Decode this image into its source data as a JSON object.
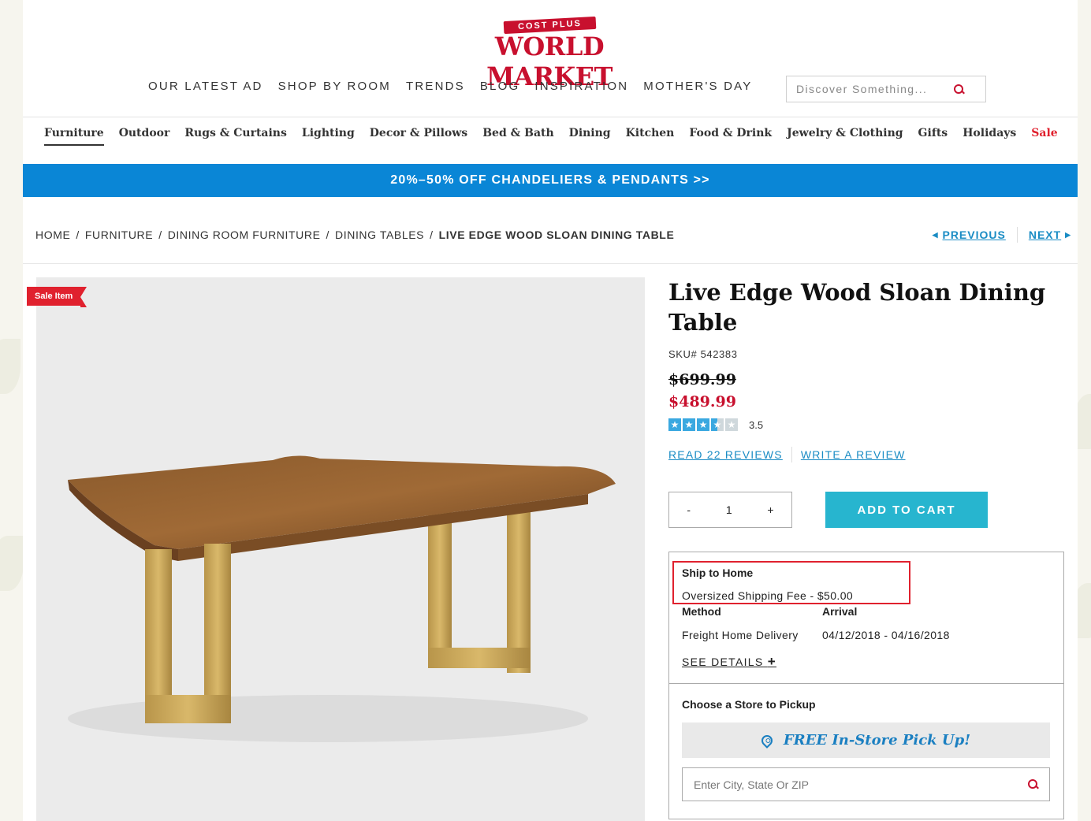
{
  "brand": {
    "ribbon": "COST PLUS",
    "name": "WORLD MARKET",
    "color": "#c8102e"
  },
  "top_nav": [
    "OUR LATEST AD",
    "SHOP BY ROOM",
    "TRENDS",
    "BLOG",
    "INSPIRATION",
    "MOTHER'S DAY"
  ],
  "search": {
    "placeholder": "Discover Something..."
  },
  "categories": [
    "Furniture",
    "Outdoor",
    "Rugs & Curtains",
    "Lighting",
    "Decor & Pillows",
    "Bed & Bath",
    "Dining",
    "Kitchen",
    "Food & Drink",
    "Jewelry & Clothing",
    "Gifts",
    "Holidays",
    "Sale"
  ],
  "promo": {
    "text": "20%–50% OFF CHANDELIERS & PENDANTS >>",
    "color": "#0a86d6"
  },
  "breadcrumb": [
    "HOME",
    "FURNITURE",
    "DINING ROOM FURNITURE",
    "DINING TABLES",
    "LIVE EDGE WOOD SLOAN DINING TABLE"
  ],
  "pager": {
    "previous": "PREVIOUS",
    "next": "NEXT"
  },
  "product": {
    "sale_tag": "Sale Item",
    "title": "Live Edge Wood Sloan Dining Table",
    "sku": "SKU# 542383",
    "old_price": "$699.99",
    "sale_price": "$489.99",
    "rating": 3.5,
    "rating_text": "3.5",
    "read_reviews": "READ 22 REVIEWS",
    "write_review": "WRITE A REVIEW",
    "quantity": "1",
    "qty_minus": "-",
    "qty_plus": "+",
    "add_to_cart": "ADD TO CART"
  },
  "shipping": {
    "title": "Ship to Home",
    "fee": "Oversized Shipping Fee - $50.00",
    "method_header": "Method",
    "arrival_header": "Arrival",
    "method": "Freight Home Delivery",
    "arrival": "04/12/2018 - 04/16/2018",
    "see_details": "SEE DETAILS",
    "see_details_icon": "+"
  },
  "pickup": {
    "title": "Choose a Store to Pickup",
    "button": "FREE In-Store Pick Up!",
    "placeholder": "Enter City, State Or ZIP"
  }
}
